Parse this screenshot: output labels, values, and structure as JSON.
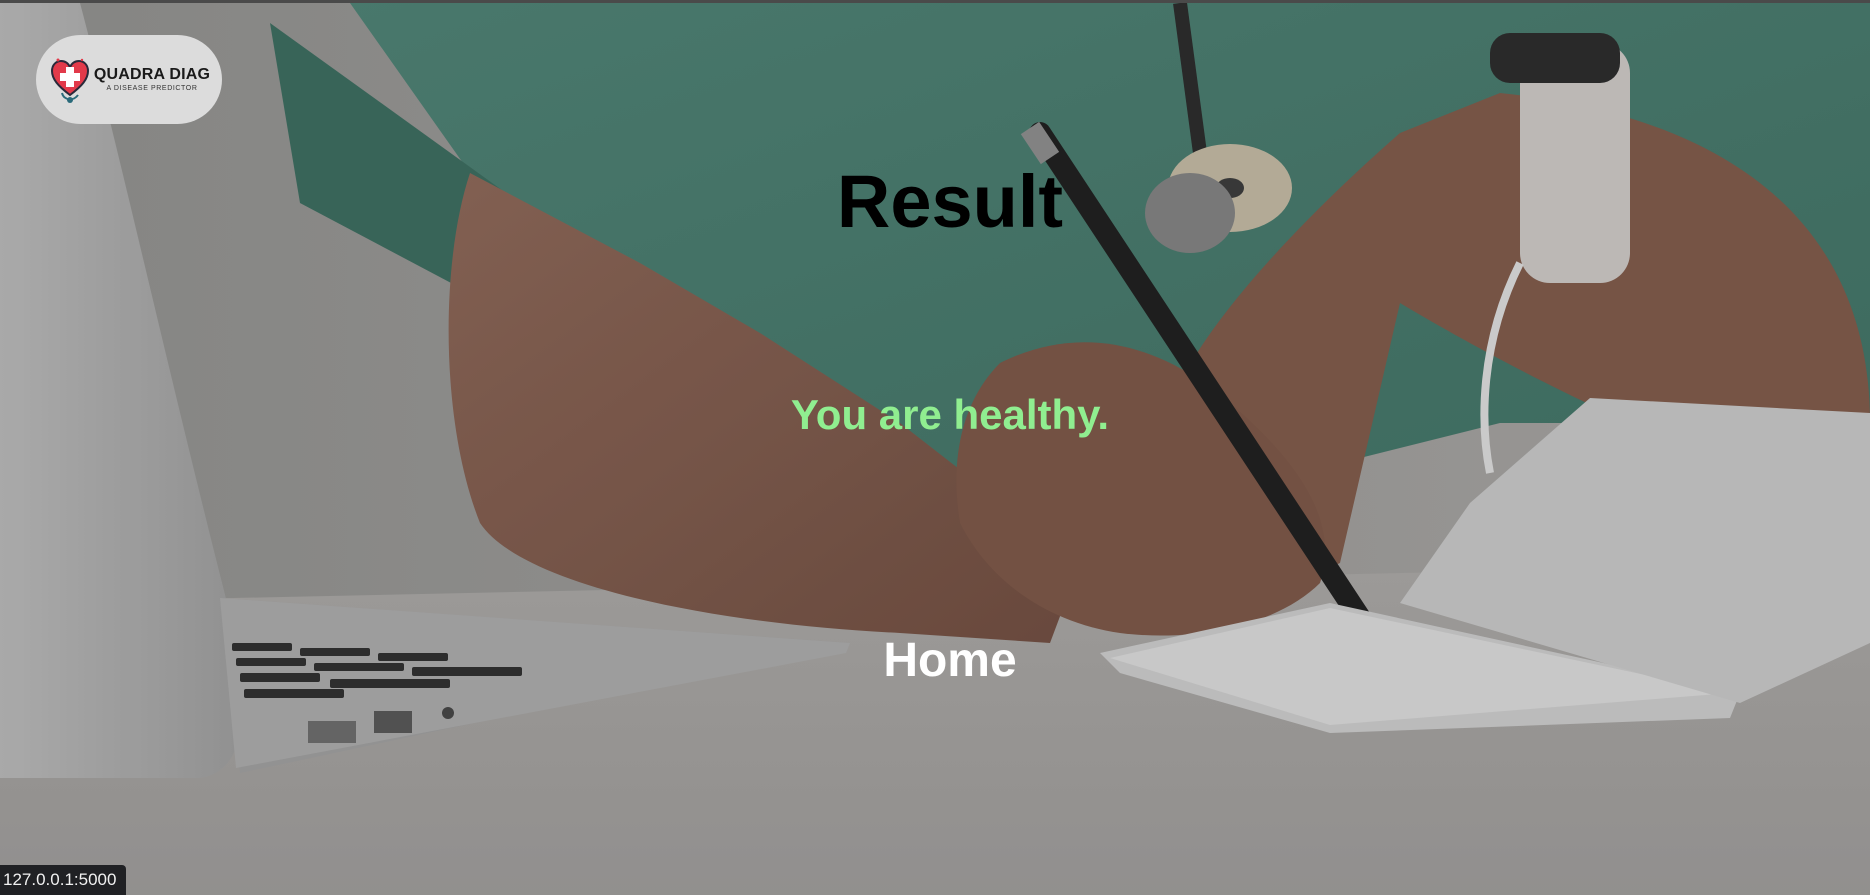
{
  "logo": {
    "title": "QUADRA DIAG",
    "subtitle": "A DISEASE PREDICTOR"
  },
  "result": {
    "title": "Result",
    "message": "You are healthy."
  },
  "nav": {
    "home_label": "Home"
  },
  "status_bar": {
    "url": "127.0.0.1:5000"
  },
  "colors": {
    "message": "#90ee90",
    "title": "#000000",
    "home": "#ffffff",
    "logo_bg": "#dcdcdc"
  }
}
